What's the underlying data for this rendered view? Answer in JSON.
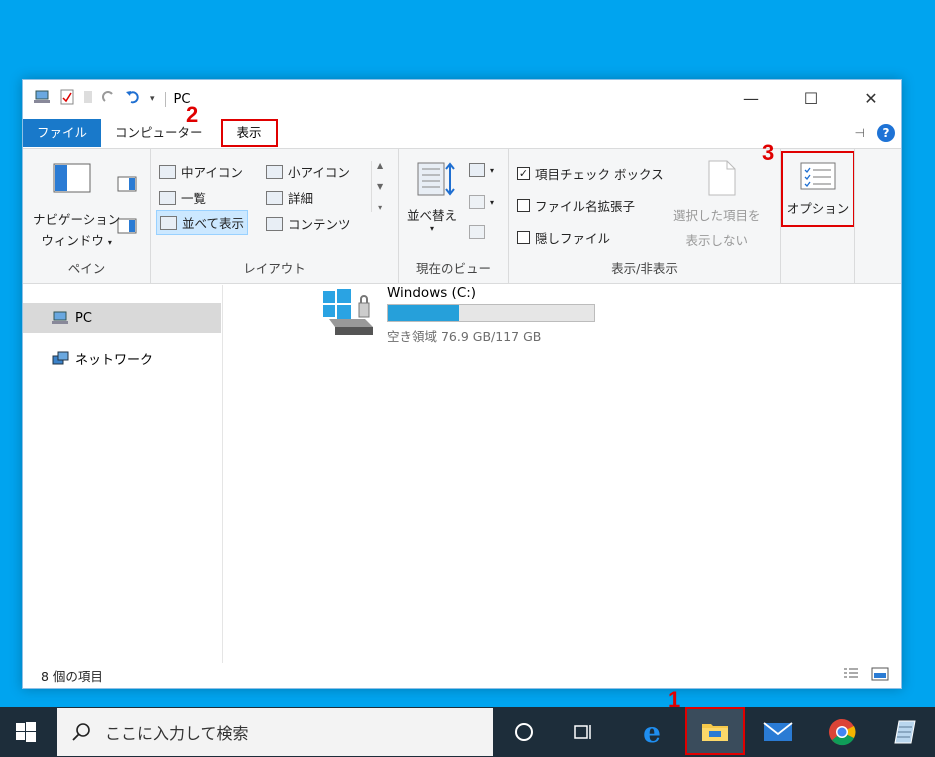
{
  "window": {
    "title": "PC",
    "controls": {
      "minimize": "—",
      "maximize": "☐",
      "close": "✕"
    }
  },
  "tabs": {
    "file": "ファイル",
    "computer": "コンピューター",
    "view": "表示"
  },
  "ribbon": {
    "pane": {
      "label": "ペイン",
      "navigation_line1": "ナビゲーション",
      "navigation_line2": "ウィンドウ"
    },
    "layout": {
      "label": "レイアウト",
      "medium_icons": "中アイコン",
      "small_icons": "小アイコン",
      "list": "一覧",
      "details": "詳細",
      "tiles": "並べて表示",
      "content": "コンテンツ"
    },
    "current_view": {
      "label": "現在のビュー",
      "sort_by": "並べ替え"
    },
    "show_hide": {
      "label": "表示/非表示",
      "item_checkboxes": "項目チェック ボックス",
      "file_extensions": "ファイル名拡張子",
      "hidden_items": "隠しファイル",
      "hide_selected_line1": "選択した項目を",
      "hide_selected_line2": "表示しない"
    },
    "options": "オプション"
  },
  "nav": {
    "pc": "PC",
    "network": "ネットワーク"
  },
  "content": {
    "drive_name": "Windows (C:)",
    "drive_free": "空き領域 76.9 GB/117 GB",
    "drive_used_fraction": 0.343
  },
  "status": {
    "item_count": "8 個の項目"
  },
  "taskbar": {
    "search_placeholder": "ここに入力して検索"
  },
  "annotations": {
    "step1": "1",
    "step2": "2",
    "step3": "3"
  },
  "colors": {
    "accent": "#1979ca",
    "highlight": "#e00000",
    "desktop": "#00a4ef",
    "progress": "#26a0da"
  }
}
